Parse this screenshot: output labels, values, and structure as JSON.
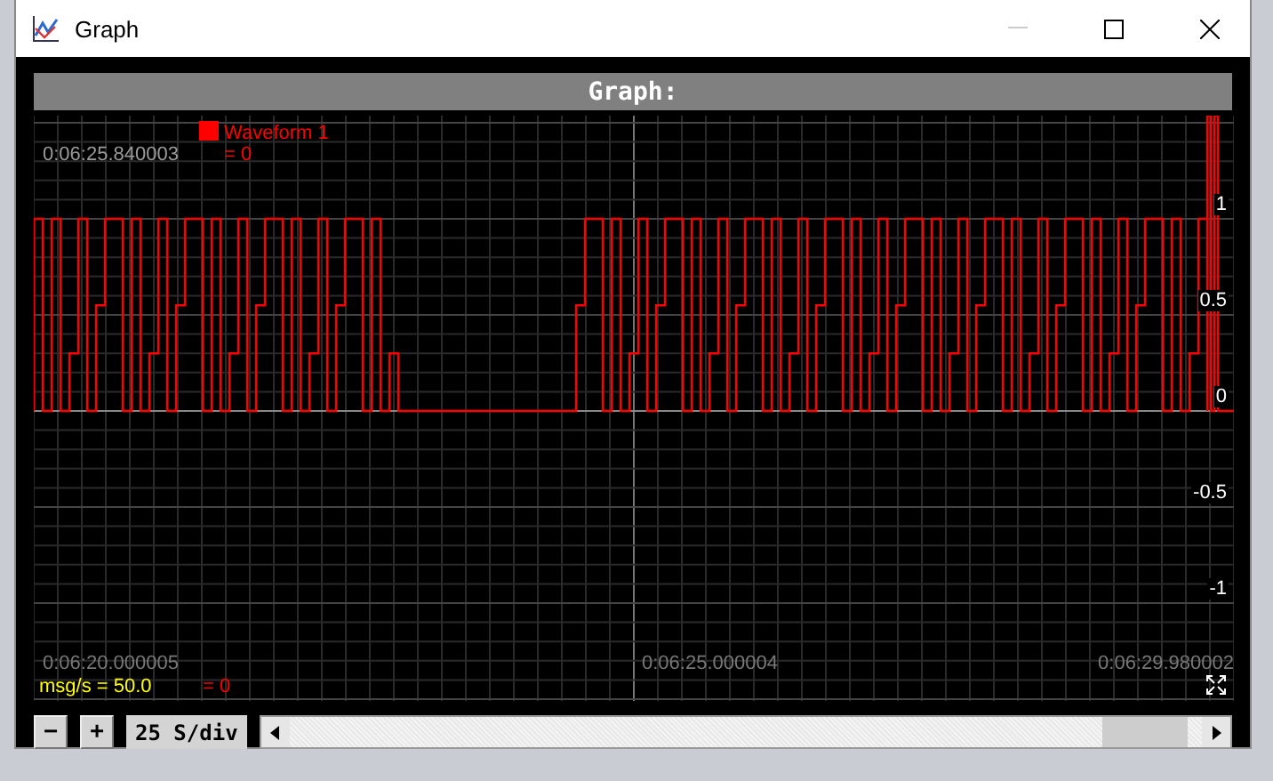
{
  "window": {
    "title": "Graph",
    "minimize_disabled": true
  },
  "graph": {
    "title": "Graph:",
    "cursor_time": "0:06:25.840003",
    "legend": [
      {
        "name": "Waveform 1",
        "value": "= 0",
        "color": "#ff0000"
      }
    ],
    "y_ticks": [
      "1",
      "0.5",
      "0",
      "-0.5",
      "-1"
    ],
    "x_labels": [
      "0:06:20.000005",
      "0:06:25.000004",
      "0:06:29.980002"
    ],
    "rate": "msg/s = 50.0",
    "readout": "= 0"
  },
  "controls": {
    "zoom_out": "−",
    "zoom_in": "+",
    "scale": "25 S/div"
  }
}
